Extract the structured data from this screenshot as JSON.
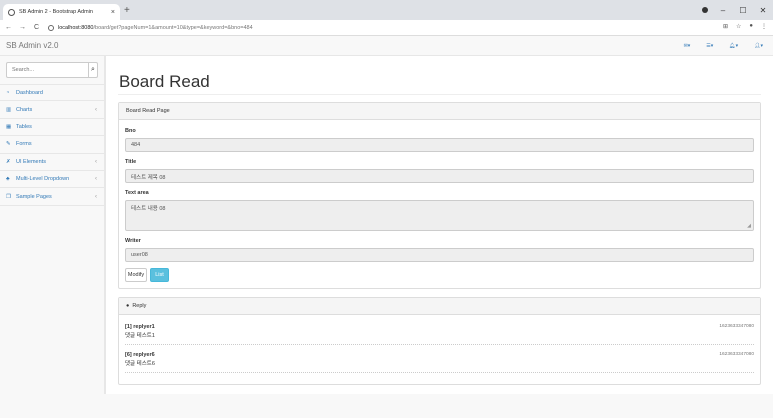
{
  "browser": {
    "tab_title": "SB Admin 2 - Bootstrap Admin",
    "tab_close": "×",
    "new_tab": "+",
    "url_host": "localhost:8080",
    "url_path": "/board/get?pageNum=1&amount=10&type=&keyword=&bno=484",
    "window_controls": [
      "–",
      "☐",
      "✕"
    ]
  },
  "navbar": {
    "brand": "SB Admin v2.0",
    "icons": [
      "envelope-icon",
      "tasks-icon",
      "bell-icon",
      "user-icon"
    ]
  },
  "sidebar": {
    "search_placeholder": "Search...",
    "items": [
      {
        "label": "Dashboard",
        "icon": "dashboard-icon",
        "has_arrow": false
      },
      {
        "label": "Charts",
        "icon": "bar-chart-icon",
        "has_arrow": true
      },
      {
        "label": "Tables",
        "icon": "table-icon",
        "has_arrow": false
      },
      {
        "label": "Forms",
        "icon": "edit-icon",
        "has_arrow": false
      },
      {
        "label": "UI Elements",
        "icon": "wrench-icon",
        "has_arrow": true
      },
      {
        "label": "Multi-Level Dropdown",
        "icon": "sitemap-icon",
        "has_arrow": true
      },
      {
        "label": "Sample Pages",
        "icon": "files-icon",
        "has_arrow": true
      }
    ]
  },
  "main": {
    "page_title": "Board Read",
    "panel_title": "Board Read Page",
    "fields": {
      "bno_label": "Bno",
      "bno_value": "484",
      "title_label": "Title",
      "title_value": "테스트 제목 08",
      "content_label": "Text area",
      "content_value": "테스트 내용 08",
      "writer_label": "Writer",
      "writer_value": "user08"
    },
    "buttons": {
      "modify": "Modify",
      "list": "List"
    }
  },
  "reply": {
    "panel_title": "Reply",
    "items": [
      {
        "header": "[1] replyer1",
        "text": "댓글 테스트1",
        "timestamp": "1623633347080"
      },
      {
        "header": "[6] replyer6",
        "text": "댓글 테스트6",
        "timestamp": "1623633347080"
      }
    ]
  },
  "colors": {
    "link": "#337ab7",
    "info_button": "#5bc0de",
    "readonly_bg": "#eeeeee"
  }
}
